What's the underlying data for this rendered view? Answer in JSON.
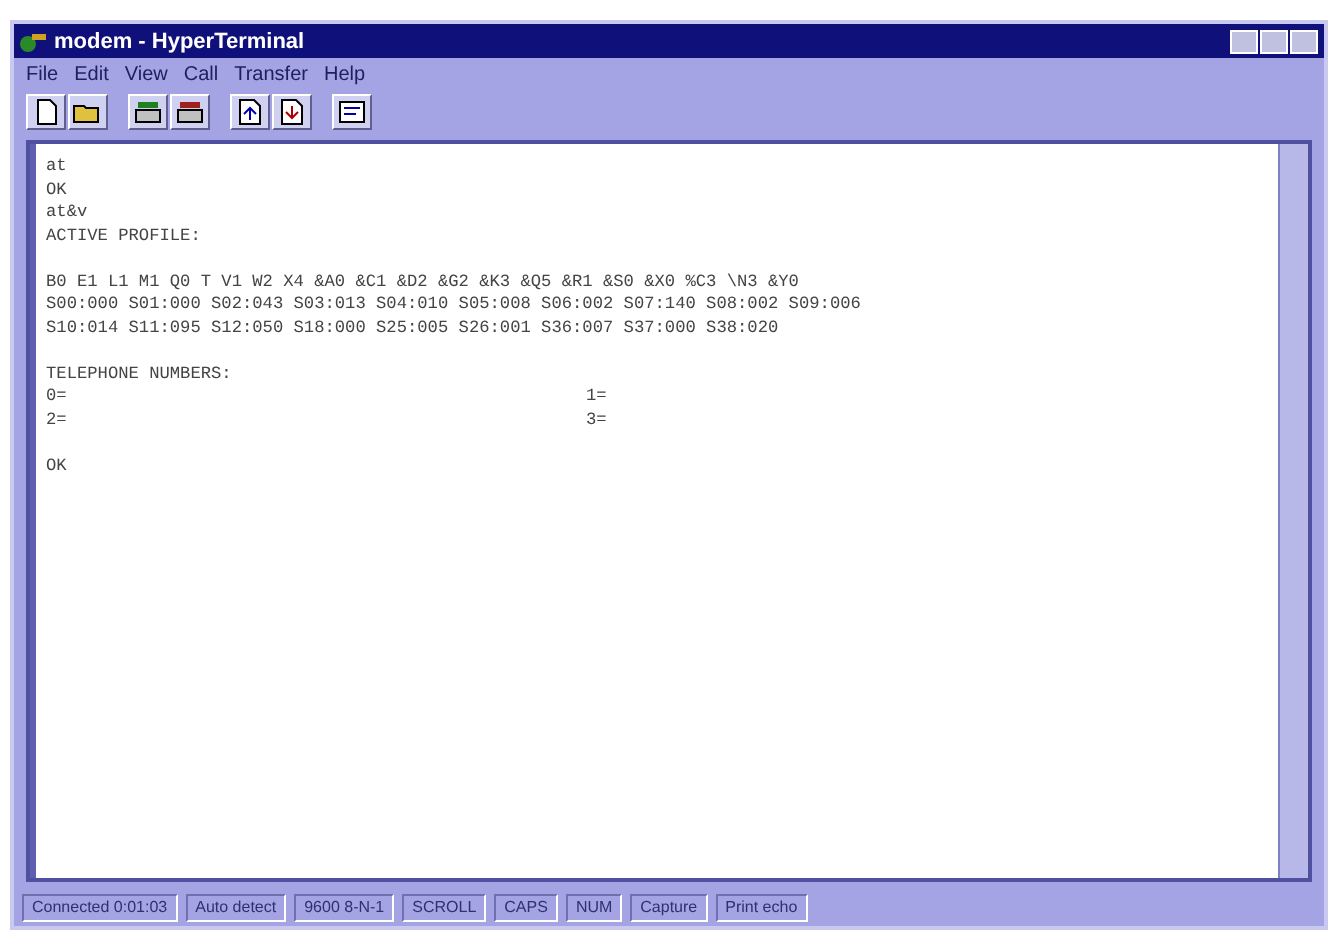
{
  "window": {
    "title": "modem - HyperTerminal"
  },
  "menu": [
    "File",
    "Edit",
    "View",
    "Call",
    "Transfer",
    "Help"
  ],
  "toolbar": [
    {
      "kind": "new"
    },
    {
      "kind": "open"
    },
    {
      "kind": "gap"
    },
    {
      "kind": "call"
    },
    {
      "kind": "hangup"
    },
    {
      "kind": "gap"
    },
    {
      "kind": "send"
    },
    {
      "kind": "receive"
    },
    {
      "kind": "gap"
    },
    {
      "kind": "properties"
    }
  ],
  "terminal": {
    "lines": [
      {
        "text": "at"
      },
      {
        "text": "OK"
      },
      {
        "text": "at&v"
      },
      {
        "text": "ACTIVE PROFILE:"
      },
      {
        "text": "B0 E1 L1 M1 Q0 T V1 W2 X4 &A0 &C1 &D2 &G2 &K3 &Q5 &R1 &S0 &X0 %C3 \\N3 &Y0",
        "blank_line_before": true
      },
      {
        "text": "S00:000 S01:000 S02:043 S03:013 S04:010 S05:008 S06:002 S07:140 S08:002 S09:006"
      },
      {
        "text": "S10:014 S11:095 S12:050 S18:000 S25:005 S26:001 S36:007 S37:000 S38:020"
      },
      {
        "text": "TELEPHONE NUMBERS:",
        "blank_line_before": true
      },
      {
        "text": "0=",
        "col2": "1="
      },
      {
        "text": "2=",
        "col2": "3="
      },
      {
        "text": "OK",
        "blank_line_before": true
      }
    ]
  },
  "status_bar": [
    "Connected 0:01:03",
    "Auto detect",
    "9600 8-N-1",
    "SCROLL",
    "CAPS",
    "NUM",
    "Capture",
    "Print echo"
  ]
}
